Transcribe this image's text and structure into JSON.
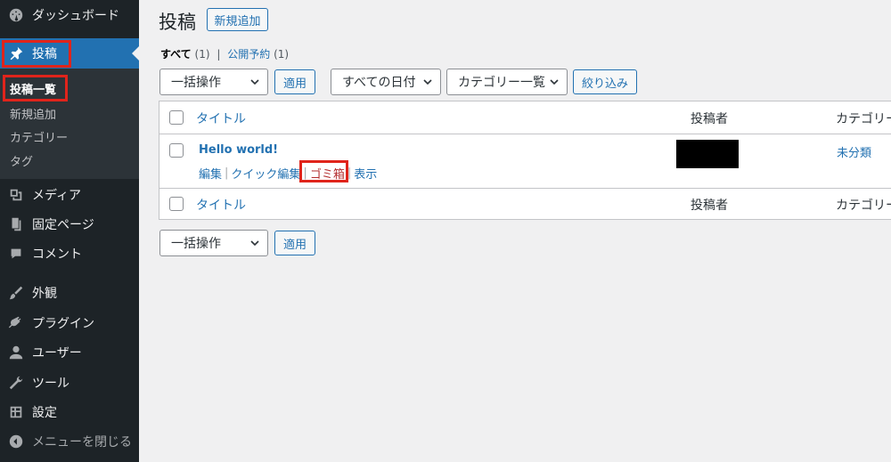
{
  "sidebar": {
    "items": [
      {
        "id": "dashboard",
        "label": "ダッシュボード",
        "icon": "dashboard-icon"
      },
      {
        "id": "posts",
        "label": "投稿",
        "icon": "pushpin-icon",
        "current": true
      },
      {
        "id": "media",
        "label": "メディア",
        "icon": "media-icon"
      },
      {
        "id": "pages",
        "label": "固定ページ",
        "icon": "page-icon"
      },
      {
        "id": "comments",
        "label": "コメント",
        "icon": "comment-icon"
      },
      {
        "id": "appearance",
        "label": "外観",
        "icon": "brush-icon"
      },
      {
        "id": "plugins",
        "label": "プラグイン",
        "icon": "plugin-icon"
      },
      {
        "id": "users",
        "label": "ユーザー",
        "icon": "user-icon"
      },
      {
        "id": "tools",
        "label": "ツール",
        "icon": "wrench-icon"
      },
      {
        "id": "settings",
        "label": "設定",
        "icon": "settings-icon"
      }
    ],
    "submenu": [
      "投稿一覧",
      "新規追加",
      "カテゴリー",
      "タグ"
    ],
    "collapse_label": "メニューを閉じる"
  },
  "header": {
    "title": "投稿",
    "add_new": "新規追加"
  },
  "views": {
    "all_label": "すべて",
    "all_count": "(1)",
    "separator": "|",
    "scheduled_label": "公開予約",
    "scheduled_count": "(1)"
  },
  "filters": {
    "bulk_action": "一括操作",
    "apply": "適用",
    "dates": "すべての日付",
    "categories": "カテゴリー一覧",
    "filter": "絞り込み"
  },
  "table": {
    "columns": [
      "タイトル",
      "投稿者",
      "カテゴリー"
    ],
    "rows": [
      {
        "title": "Hello world!",
        "actions": [
          "編集",
          "クイック編集",
          "ゴミ箱",
          "表示"
        ],
        "category": "未分類"
      }
    ]
  },
  "colors": {
    "accent": "#2271b1",
    "sidebar_bg": "#1d2327",
    "highlight_box": "#e0241b",
    "trash": "#b32d2e"
  }
}
